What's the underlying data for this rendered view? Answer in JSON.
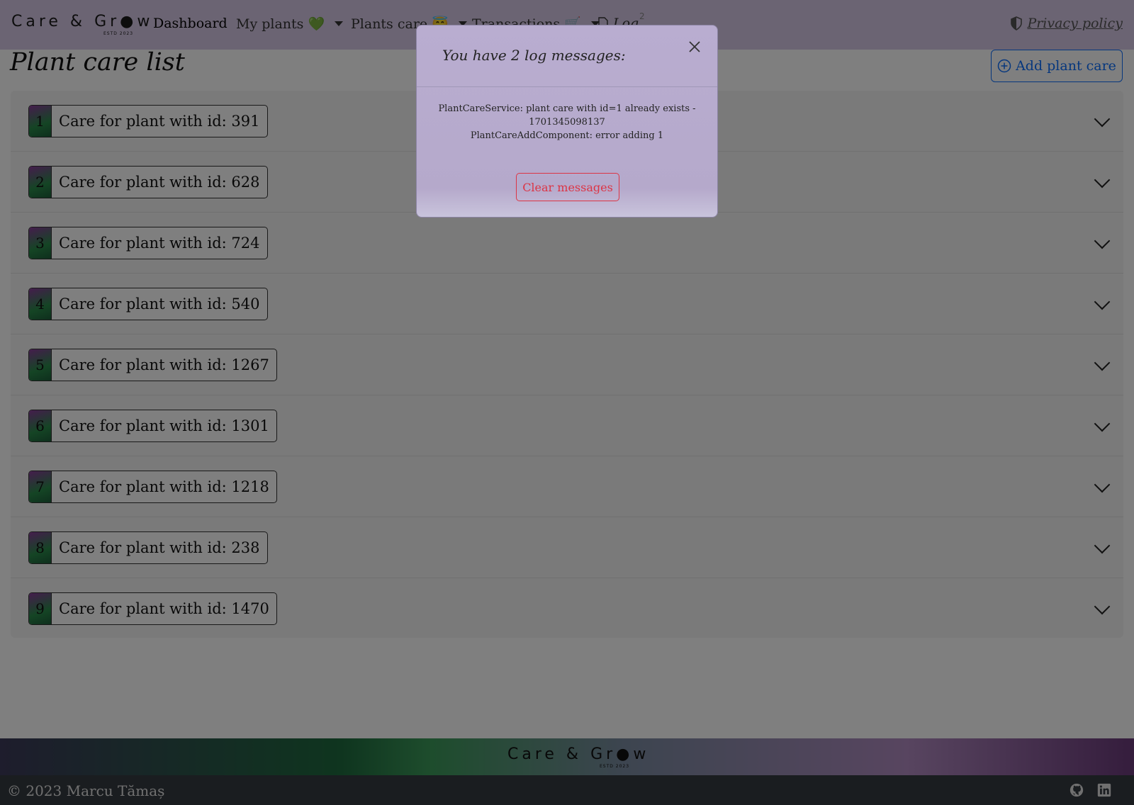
{
  "navbar": {
    "brand": "Care & Gr●w",
    "brand_estd": "ESTD 2023",
    "items": [
      {
        "label": "Dashboard"
      },
      {
        "label": "My plants 💚"
      },
      {
        "label": "Plants care 😇"
      },
      {
        "label": "Transactions 🛒"
      },
      {
        "label": "Log"
      }
    ],
    "log_badge": "2",
    "privacy": "Privacy policy"
  },
  "page": {
    "title": "Plant care list",
    "add_button": "Add plant care"
  },
  "accordion": {
    "items": [
      {
        "num": "1",
        "label": "Care for plant with id: 391"
      },
      {
        "num": "2",
        "label": "Care for plant with id: 628"
      },
      {
        "num": "3",
        "label": "Care for plant with id: 724"
      },
      {
        "num": "4",
        "label": "Care for plant with id: 540"
      },
      {
        "num": "5",
        "label": "Care for plant with id: 1267"
      },
      {
        "num": "6",
        "label": "Care for plant with id: 1301"
      },
      {
        "num": "7",
        "label": "Care for plant with id: 1218"
      },
      {
        "num": "8",
        "label": "Care for plant with id: 238"
      },
      {
        "num": "9",
        "label": "Care for plant with id: 1470"
      }
    ]
  },
  "modal": {
    "title": "You have 2 log messages:",
    "messages": [
      "PlantCareService: plant care with id=1 already exists - 1701345098137",
      "PlantCareAddComponent: error adding 1"
    ],
    "clear_button": "Clear messages"
  },
  "footer": {
    "brand": "Care & Gr●w",
    "brand_estd": "ESTD 2023",
    "copyright": "© 2023 Marcu Tămaș",
    "icons": [
      "github-icon",
      "linkedin-icon"
    ]
  },
  "colors": {
    "navbar_bg": "#d6c8e6",
    "accent_blue": "#0d6efd",
    "danger_red": "#dc3545",
    "footer_bar": "#343a40"
  }
}
